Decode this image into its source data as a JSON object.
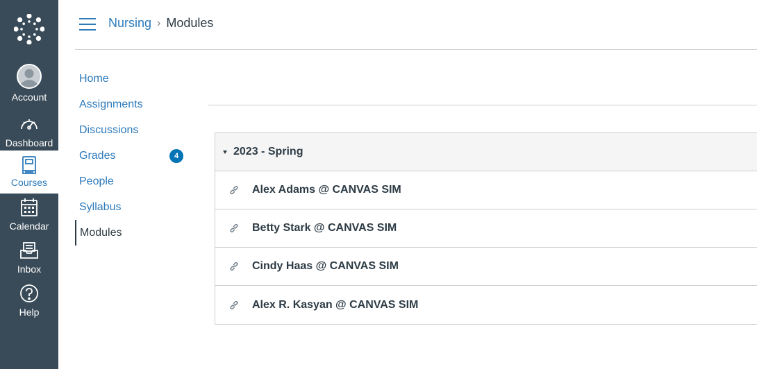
{
  "global_nav": {
    "logo_icon": "canvas-logo-icon",
    "items": [
      {
        "label": "Account",
        "icon": "account-avatar-icon"
      },
      {
        "label": "Dashboard",
        "icon": "dashboard-gauge-icon"
      },
      {
        "label": "Courses",
        "icon": "courses-book-icon",
        "active": true
      },
      {
        "label": "Calendar",
        "icon": "calendar-icon"
      },
      {
        "label": "Inbox",
        "icon": "inbox-icon"
      },
      {
        "label": "Help",
        "icon": "help-icon"
      }
    ],
    "colors": {
      "background": "#394B58",
      "active_background": "#FFFFFF",
      "active_text": "#2D7ABB"
    }
  },
  "header": {
    "menu_icon": "hamburger-icon",
    "breadcrumb": {
      "course": "Nursing",
      "separator": "›",
      "current": "Modules"
    }
  },
  "course_nav": {
    "items": [
      {
        "label": "Home"
      },
      {
        "label": "Assignments"
      },
      {
        "label": "Discussions"
      },
      {
        "label": "Grades",
        "badge": "4"
      },
      {
        "label": "People"
      },
      {
        "label": "Syllabus"
      },
      {
        "label": "Modules",
        "active": true
      }
    ]
  },
  "module": {
    "title": "2023 - Spring",
    "expanded": true,
    "items": [
      {
        "title": "Alex Adams @ CANVAS SIM",
        "icon": "external-link-icon"
      },
      {
        "title": "Betty Stark @ CANVAS SIM",
        "icon": "external-link-icon"
      },
      {
        "title": "Cindy Haas @ CANVAS SIM",
        "icon": "external-link-icon"
      },
      {
        "title": "Alex R. Kasyan @ CANVAS SIM",
        "icon": "external-link-icon"
      }
    ]
  },
  "colors": {
    "link": "#2D7ABB",
    "text": "#2D3B45",
    "border": "#C7CDD1",
    "badge": "#0374B5"
  }
}
